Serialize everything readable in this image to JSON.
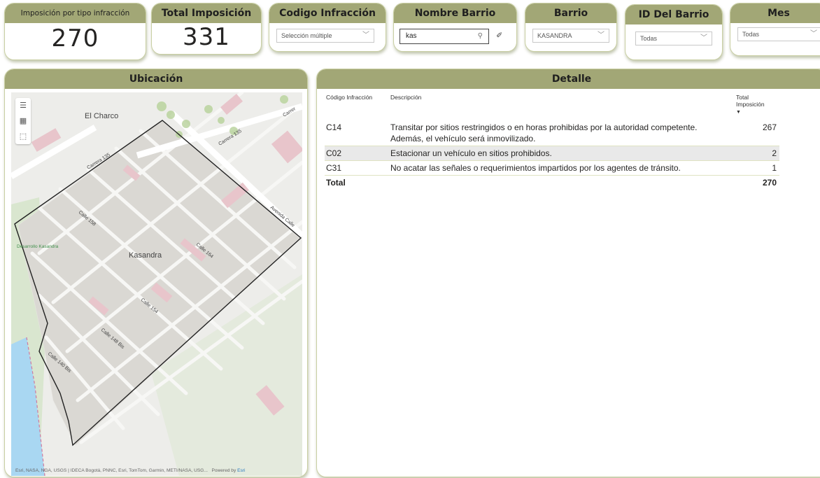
{
  "kpi_impos_tipo": {
    "label": "Imposición por tipo infracción",
    "value": "270"
  },
  "kpi_total": {
    "label": "Total Imposición",
    "value": "331"
  },
  "filters": {
    "codigo": {
      "label": "Codigo Infracción",
      "value": "Selección múltiple"
    },
    "nombre_barrio": {
      "label": "Nombre Barrio",
      "search_value": "kas"
    },
    "barrio": {
      "label": "Barrio",
      "value": "KASANDRA"
    },
    "id_barrio": {
      "label": "ID Del Barrio",
      "value": "Todas"
    },
    "mes": {
      "label": "Mes",
      "value": "Todas"
    }
  },
  "map": {
    "title": "Ubicación",
    "labels": {
      "el_charco": "El Charco",
      "kasandra": "Kasandra",
      "desarrollo_kasandra": "Desarrollo Kasandra",
      "carrera_135": "Carrera 135",
      "carrera_13x": "Carrera 135",
      "carrera_top": "Carrer",
      "avenida": "Avenida Calle",
      "calle_158": "Calle 158",
      "calle_164": "Calle 164",
      "calle_154": "Calle 154",
      "calle_148": "Calle 148 Bis",
      "calle_140": "Calle 140 Bis"
    },
    "attribution": "Esri, NASA, NGA, USGS | IDECA Bogotá, PNNC, Esri, TomTom, Garmin, METI/NASA, USG...",
    "powered": "Powered by ",
    "esri": "Esri"
  },
  "detalle": {
    "title": "Detalle",
    "columns": [
      "Código Infracción",
      "Descripción",
      "Total Imposición"
    ],
    "rows": [
      {
        "codigo": "C14",
        "desc": "Transitar por sitios restringidos o en horas prohibidas por la autoridad competente. Además, el vehículo será inmovilizado.",
        "total": "267"
      },
      {
        "codigo": "C02",
        "desc": "Estacionar un vehículo en sitios prohibidos.",
        "total": "2"
      },
      {
        "codigo": "C31",
        "desc": "No acatar las señales o requerimientos impartidos por los agentes de tránsito.",
        "total": "1"
      }
    ],
    "total_label": "Total",
    "total_value": "270"
  },
  "colors": {
    "header": "#a2a776",
    "border": "#c9cfa3",
    "polygon": "#222222",
    "highlight": "#e9e9e9"
  },
  "icons": [
    "search-icon",
    "eraser-icon",
    "chevron-down-icon",
    "hamburger-icon",
    "qr-icon",
    "select-box-icon",
    "sort-desc-icon"
  ]
}
